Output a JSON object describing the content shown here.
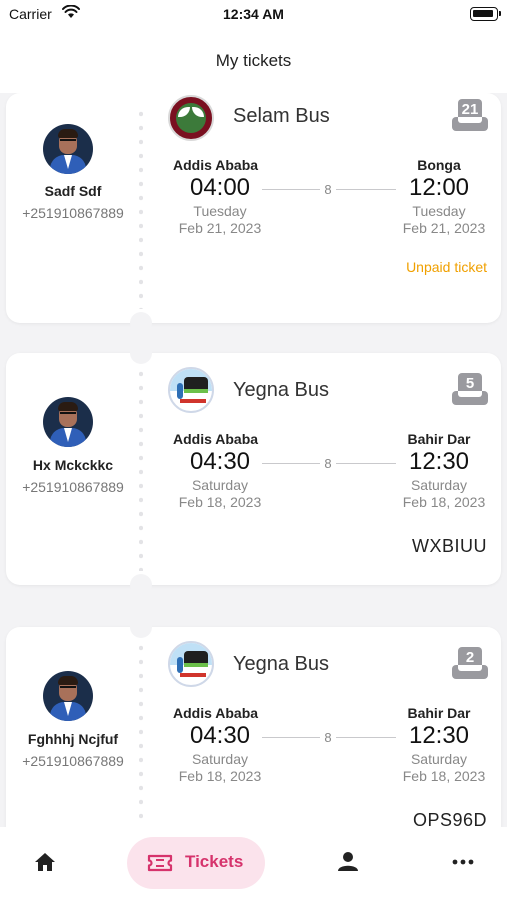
{
  "status_bar": {
    "carrier": "Carrier",
    "time": "12:34 AM"
  },
  "header": {
    "title": "My tickets"
  },
  "tickets": [
    {
      "passenger_name": "Sadf Sdf",
      "passenger_phone": "+251910867889",
      "bus_name": "Selam Bus",
      "logo": "selam-bus-logo",
      "seat_number": "21",
      "from_city": "Addis Ababa",
      "from_time": "04:00",
      "from_day": "Tuesday",
      "from_date": "Feb 21, 2023",
      "to_city": "Bonga",
      "to_time": "12:00",
      "to_day": "Tuesday",
      "to_date": "Feb 21, 2023",
      "duration": "8",
      "status": "Unpaid ticket",
      "code": ""
    },
    {
      "passenger_name": "Hx Mckckkc",
      "passenger_phone": "+251910867889",
      "bus_name": "Yegna Bus",
      "logo": "yegna-bus-logo",
      "seat_number": "5",
      "from_city": "Addis Ababa",
      "from_time": "04:30",
      "from_day": "Saturday",
      "from_date": "Feb 18, 2023",
      "to_city": "Bahir Dar",
      "to_time": "12:30",
      "to_day": "Saturday",
      "to_date": "Feb 18, 2023",
      "duration": "8",
      "status": "",
      "code": "WXBIUU"
    },
    {
      "passenger_name": "Fghhhj Ncjfuf",
      "passenger_phone": "+251910867889",
      "bus_name": "Yegna Bus",
      "logo": "yegna-bus-logo",
      "seat_number": "2",
      "from_city": "Addis Ababa",
      "from_time": "04:30",
      "from_day": "Saturday",
      "from_date": "Feb 18, 2023",
      "to_city": "Bahir Dar",
      "to_time": "12:30",
      "to_day": "Saturday",
      "to_date": "Feb 18, 2023",
      "duration": "8",
      "status": "",
      "code": "OPS96D"
    }
  ],
  "bottom_nav": {
    "items": [
      {
        "icon": "home-icon",
        "label": ""
      },
      {
        "icon": "ticket-icon",
        "label": "Tickets",
        "active": true
      },
      {
        "icon": "profile-icon",
        "label": ""
      },
      {
        "icon": "more-icon",
        "label": ""
      }
    ]
  },
  "colors": {
    "accent": "#d6336c",
    "accent_bg": "#fbe3ec",
    "unpaid": "#f0a000",
    "background": "#f3f3f5"
  }
}
